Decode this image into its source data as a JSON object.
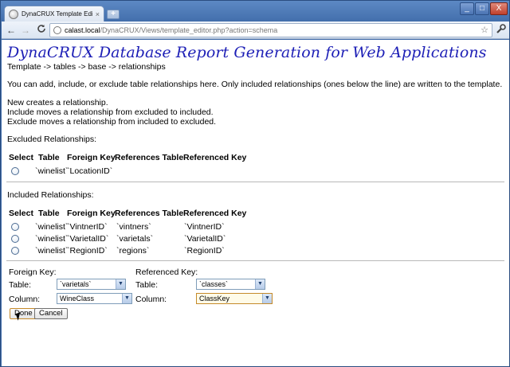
{
  "browser": {
    "tab_title": "DynaCRUX Template Editor",
    "tab_close": "×",
    "new_tab": "+",
    "url_host": "calast.local",
    "url_path": "/DynaCRUX/Views/template_editor.php?action=schema",
    "star": "☆",
    "wrench": "🔧",
    "back": "←",
    "forward": "→",
    "reload": "C",
    "min": "_",
    "max": "□",
    "close": "X"
  },
  "page": {
    "title": "DynaCRUX Database Report Generation for Web Applications",
    "breadcrumb": "Template -> tables -> base -> relationships",
    "intro": "You can add, include, or exclude table relationships here. Only included relationships (ones below the line) are written to the template.",
    "help_lines": [
      "New creates a relationship.",
      "Include moves a relationship from excluded to included.",
      "Exclude moves a relationship from included to excluded."
    ]
  },
  "excluded": {
    "heading": "Excluded Relationships:",
    "columns": [
      "Select",
      "Table",
      "Foreign Key",
      "References Table",
      "Referenced Key"
    ],
    "rows": [
      {
        "table": "`winelist`",
        "foreign_key": "`LocationID`",
        "references_table": "",
        "referenced_key": ""
      }
    ]
  },
  "included": {
    "heading": "Included Relationships:",
    "columns": [
      "Select",
      "Table",
      "Foreign Key",
      "References Table",
      "Referenced Key"
    ],
    "rows": [
      {
        "table": "`winelist`",
        "foreign_key": "`VintnerID`",
        "references_table": "`vintners`",
        "referenced_key": "`VintnerID`"
      },
      {
        "table": "`winelist`",
        "foreign_key": "`VarietalID`",
        "references_table": "`varietals`",
        "referenced_key": "`VarietalID`"
      },
      {
        "table": "`winelist`",
        "foreign_key": "`RegionID`",
        "references_table": "`regions`",
        "referenced_key": "`RegionID`"
      }
    ]
  },
  "form": {
    "fk_heading": "Foreign Key:",
    "rk_heading": "Referenced Key:",
    "table_label": "Table:",
    "column_label": "Column:",
    "fk_table": "`varietals`",
    "fk_column": "WineClass",
    "rk_table": "`classes`",
    "rk_column": "ClassKey",
    "done_button": "Done",
    "cancel_button": "Cancel"
  }
}
